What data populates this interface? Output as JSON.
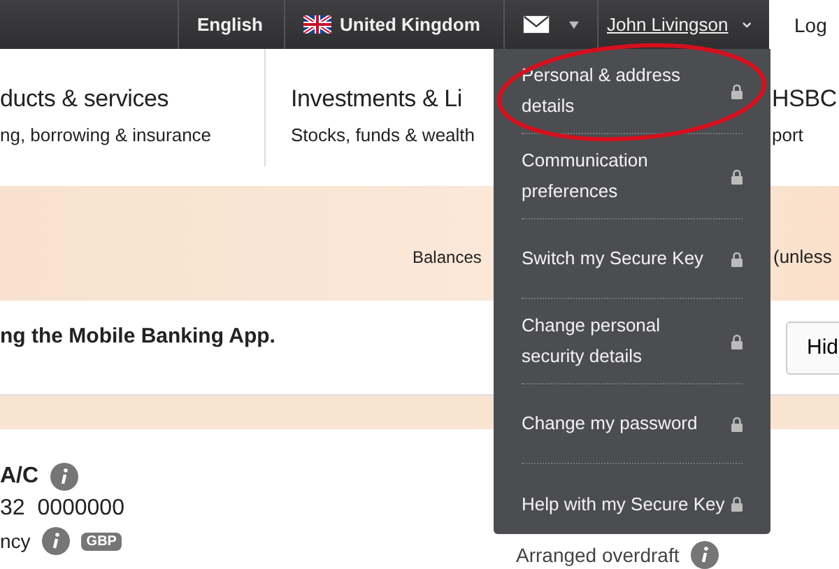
{
  "top_bar": {
    "language": "English",
    "country": "United Kingdom",
    "user": "John Livingson",
    "log": "Log"
  },
  "nav": [
    {
      "title": "ducts & services",
      "subtitle": "ng, borrowing & insurance"
    },
    {
      "title": "Investments & Li",
      "subtitle": "Stocks, funds & wealth"
    },
    {
      "title": "HSBC",
      "subtitle": "port"
    }
  ],
  "balances_band": {
    "label": "Balances",
    "note": "(unless"
  },
  "banner": {
    "text": "ng the Mobile Banking App.",
    "button": "Hid"
  },
  "account": {
    "name": "A/C",
    "number": "32  0000000",
    "currency_label": "ncy",
    "currency": "GBP",
    "overdraft": "Arranged overdraft"
  },
  "user_menu": {
    "items": [
      {
        "label": "Personal & address details",
        "locked": true,
        "highlighted": true
      },
      {
        "label": "Communication preferences",
        "locked": true,
        "highlighted": false
      },
      {
        "label": "Switch my Secure Key",
        "locked": true,
        "highlighted": false
      },
      {
        "label": "Change personal security details",
        "locked": true,
        "highlighted": false
      },
      {
        "label": "Change my password",
        "locked": true,
        "highlighted": false
      },
      {
        "label": "Help with my Secure Key",
        "locked": true,
        "highlighted": false
      }
    ]
  }
}
